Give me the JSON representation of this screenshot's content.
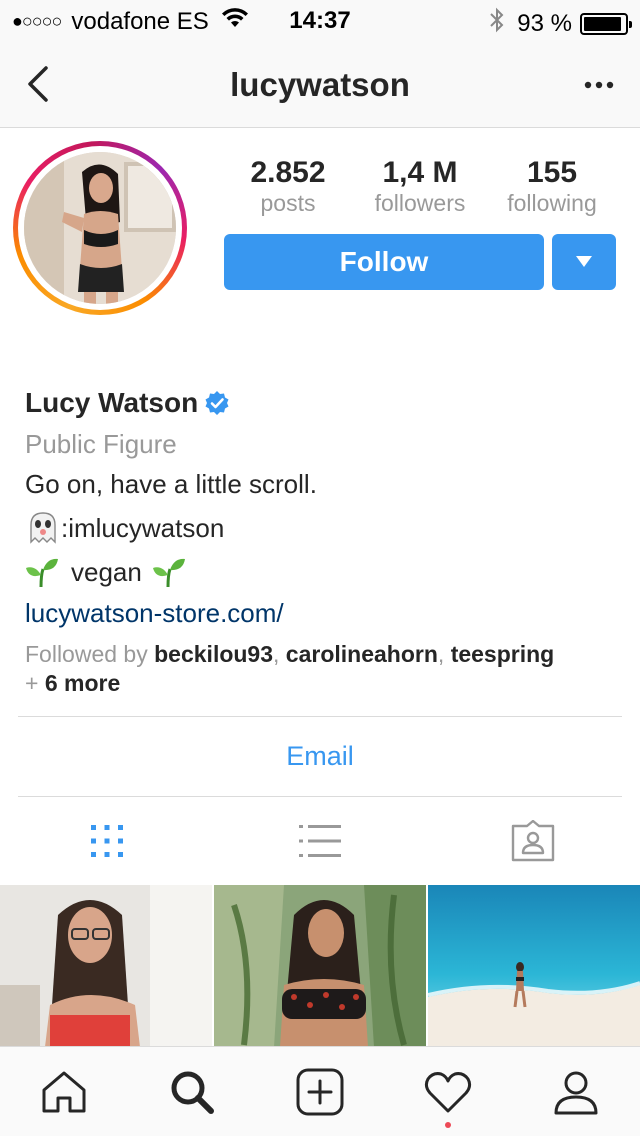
{
  "status_bar": {
    "signal": "●○○○○",
    "carrier": "vodafone ES",
    "time": "14:37",
    "battery_pct": "93 %",
    "battery_level": 0.93
  },
  "nav": {
    "title": "lucywatson",
    "back_icon": "chevron-left-icon",
    "more_icon": "more-horizontal-icon"
  },
  "profile": {
    "stats": [
      {
        "value": "2.852",
        "label": "posts"
      },
      {
        "value": "1,4 M",
        "label": "followers"
      },
      {
        "value": "155",
        "label": "following"
      }
    ],
    "follow_label": "Follow",
    "name": "Lucy Watson",
    "category": "Public Figure",
    "bio_line1": "Go on, have a little scroll.",
    "snapchat_text": ":imlucywatson",
    "vegan_text": "vegan",
    "website": "lucywatson-store.com/",
    "followed_by_prefix": "Followed by",
    "followed_by_users": [
      "beckilou93",
      "carolineahorn",
      "teespring"
    ],
    "followed_by_more_prefix": "+",
    "followed_by_more": "6 more",
    "email_label": "Email"
  },
  "colors": {
    "accent": "#3897f0",
    "link": "#003569",
    "secondary_text": "#999999",
    "notification": "#ed4956"
  },
  "view_tabs": [
    {
      "icon": "grid-icon",
      "active": true
    },
    {
      "icon": "list-icon",
      "active": false
    },
    {
      "icon": "tagged-icon",
      "active": false
    }
  ],
  "tab_bar": [
    {
      "icon": "home-icon"
    },
    {
      "icon": "search-icon"
    },
    {
      "icon": "add-post-icon"
    },
    {
      "icon": "heart-icon"
    },
    {
      "icon": "profile-icon"
    }
  ]
}
